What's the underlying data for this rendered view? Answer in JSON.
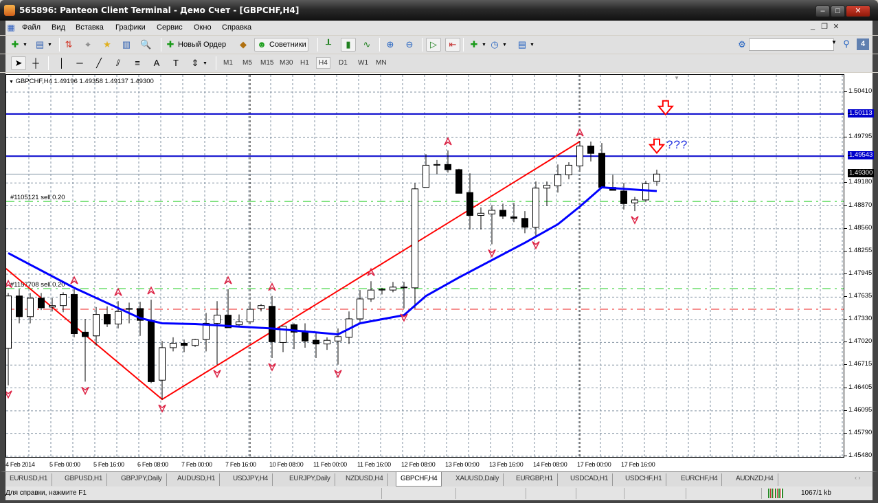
{
  "window": {
    "title": "565896: Panteon Client Terminal - Демо Счет - [GBPCHF,H4]"
  },
  "menu": [
    "Файл",
    "Вид",
    "Вставка",
    "Графики",
    "Сервис",
    "Окно",
    "Справка"
  ],
  "toolbar": {
    "new_order": "Новый Ордер",
    "experts": "Советники",
    "search_value": ""
  },
  "timeframes": [
    "M1",
    "M5",
    "M15",
    "M30",
    "H1",
    "H4",
    "D1",
    "W1",
    "MN"
  ],
  "active_timeframe": "H4",
  "chart": {
    "header": "GBPCHF,H4  1.49196 1.49358 1.49137 1.49300",
    "annotation": "???"
  },
  "chart_data": {
    "type": "candlestick",
    "symbol": "GBPCHF",
    "timeframe": "H4",
    "last_bar": {
      "open": 1.49196,
      "high": 1.49358,
      "low": 1.49137,
      "close": 1.493
    },
    "ylim": [
      1.4548,
      1.5041
    ],
    "candles": [
      [
        1.4694,
        1.4769,
        1.4644,
        1.4765
      ],
      [
        1.4765,
        1.4774,
        1.4728,
        1.4737
      ],
      [
        1.4737,
        1.4769,
        1.4728,
        1.4762
      ],
      [
        1.4762,
        1.4769,
        1.4746,
        1.4749
      ],
      [
        1.475,
        1.4762,
        1.4744,
        1.4752
      ],
      [
        1.4752,
        1.477,
        1.4743,
        1.4767
      ],
      [
        1.4767,
        1.4774,
        1.4709,
        1.4714
      ],
      [
        1.4716,
        1.4734,
        1.4649,
        1.471
      ],
      [
        1.4711,
        1.475,
        1.4698,
        1.474
      ],
      [
        1.474,
        1.4751,
        1.4723,
        1.4727
      ],
      [
        1.4727,
        1.4758,
        1.4721,
        1.4744
      ],
      [
        1.4747,
        1.4756,
        1.4728,
        1.4748
      ],
      [
        1.4748,
        1.4757,
        1.4711,
        1.4732
      ],
      [
        1.4732,
        1.476,
        1.4647,
        1.4649
      ],
      [
        1.4651,
        1.4704,
        1.4625,
        1.4695
      ],
      [
        1.4695,
        1.4709,
        1.469,
        1.4701
      ],
      [
        1.4701,
        1.4706,
        1.4689,
        1.4698
      ],
      [
        1.4698,
        1.4707,
        1.4696,
        1.4706
      ],
      [
        1.4706,
        1.4742,
        1.469,
        1.4728
      ],
      [
        1.4728,
        1.4758,
        1.4672,
        1.4739
      ],
      [
        1.4739,
        1.4774,
        1.4723,
        1.4722
      ],
      [
        1.4726,
        1.474,
        1.4723,
        1.473
      ],
      [
        1.473,
        1.4756,
        1.4728,
        1.4747
      ],
      [
        1.4748,
        1.4754,
        1.4744,
        1.4752
      ],
      [
        1.4751,
        1.4765,
        1.4681,
        1.4703
      ],
      [
        1.4702,
        1.4724,
        1.4689,
        1.4724
      ],
      [
        1.4726,
        1.4728,
        1.4693,
        1.4716
      ],
      [
        1.4716,
        1.4728,
        1.4695,
        1.4704
      ],
      [
        1.4705,
        1.4716,
        1.4681,
        1.47
      ],
      [
        1.47,
        1.4709,
        1.4692,
        1.4705
      ],
      [
        1.4704,
        1.4721,
        1.4672,
        1.471
      ],
      [
        1.4709,
        1.4744,
        1.47,
        1.4734
      ],
      [
        1.4734,
        1.4773,
        1.473,
        1.4761
      ],
      [
        1.4761,
        1.4785,
        1.4757,
        1.4773
      ],
      [
        1.4773,
        1.4776,
        1.4767,
        1.4774
      ],
      [
        1.4773,
        1.4784,
        1.477,
        1.4777
      ],
      [
        1.4777,
        1.4784,
        1.4748,
        1.4776
      ],
      [
        1.4776,
        1.4918,
        1.4748,
        1.491
      ],
      [
        1.4912,
        1.4957,
        1.4912,
        1.4942
      ],
      [
        1.4942,
        1.4949,
        1.493,
        1.4943
      ],
      [
        1.4943,
        1.4962,
        1.4932,
        1.4936
      ],
      [
        1.4936,
        1.4937,
        1.4904,
        1.4904
      ],
      [
        1.4905,
        1.4931,
        1.4855,
        1.4874
      ],
      [
        1.4874,
        1.4885,
        1.4855,
        1.4877
      ],
      [
        1.4876,
        1.4888,
        1.4835,
        1.4881
      ],
      [
        1.4881,
        1.489,
        1.4869,
        1.4873
      ],
      [
        1.4872,
        1.4891,
        1.4865,
        1.487
      ],
      [
        1.487,
        1.488,
        1.485,
        1.4858
      ],
      [
        1.4858,
        1.492,
        1.4846,
        1.4911
      ],
      [
        1.4911,
        1.492,
        1.4887,
        1.4915
      ],
      [
        1.4914,
        1.4943,
        1.4905,
        1.4929
      ],
      [
        1.4929,
        1.4946,
        1.4923,
        1.4942
      ],
      [
        1.4941,
        1.4974,
        1.4933,
        1.4968
      ],
      [
        1.4968,
        1.4974,
        1.4947,
        1.4958
      ],
      [
        1.4958,
        1.4972,
        1.4912,
        1.4912
      ],
      [
        1.4912,
        1.4929,
        1.4908,
        1.4908
      ],
      [
        1.4907,
        1.4918,
        1.4882,
        1.489
      ],
      [
        1.4891,
        1.4899,
        1.488,
        1.4895
      ],
      [
        1.4895,
        1.4921,
        1.4892,
        1.4917
      ],
      [
        1.492,
        1.4936,
        1.4914,
        1.493
      ]
    ],
    "moving_average": [
      [
        0,
        1.4823
      ],
      [
        6,
        1.4776
      ],
      [
        12,
        1.4735
      ],
      [
        14,
        1.4728
      ],
      [
        17,
        1.4727
      ],
      [
        24,
        1.4721
      ],
      [
        30,
        1.4713
      ],
      [
        32,
        1.4728
      ],
      [
        36,
        1.4739
      ],
      [
        38,
        1.4765
      ],
      [
        41,
        1.479
      ],
      [
        47,
        1.4837
      ],
      [
        50,
        1.4862
      ],
      [
        52,
        1.4886
      ],
      [
        54,
        1.4912
      ],
      [
        56,
        1.491
      ],
      [
        59,
        1.4907
      ]
    ],
    "zigzag": [
      [
        -0.2,
        1.4802
      ],
      [
        14,
        1.4625
      ],
      [
        52,
        1.4974
      ]
    ],
    "fractals_up": [
      [
        0,
        1.4769
      ],
      [
        6,
        1.4774
      ],
      [
        10,
        1.4758
      ],
      [
        13,
        1.476
      ],
      [
        20,
        1.4774
      ],
      [
        24,
        1.4765
      ],
      [
        33,
        1.4785
      ],
      [
        40,
        1.4962
      ],
      [
        52,
        1.4974
      ]
    ],
    "fractals_down": [
      [
        0,
        1.4644
      ],
      [
        7,
        1.4649
      ],
      [
        14,
        1.4625
      ],
      [
        19,
        1.4672
      ],
      [
        24,
        1.4681
      ],
      [
        30,
        1.4672
      ],
      [
        36,
        1.4748
      ],
      [
        44,
        1.4835
      ],
      [
        48,
        1.4846
      ],
      [
        57,
        1.488
      ]
    ],
    "hlines": [
      {
        "price": 1.50113,
        "color": "#0000cc",
        "style": "solid",
        "label": "1.50113"
      },
      {
        "price": 1.49543,
        "color": "#0000cc",
        "style": "solid",
        "label": "1.49543"
      },
      {
        "price": 1.493,
        "color": "#8899aa",
        "style": "thin",
        "label": "1.49300"
      },
      {
        "price": 1.4893,
        "color": "#22cc22",
        "style": "dashdot",
        "label": "#1105121 sell 0.20"
      },
      {
        "price": 1.4775,
        "color": "#22cc22",
        "style": "dashdot",
        "label": "#1157708 sell 0.20"
      },
      {
        "price": 1.4747,
        "color": "#ee2222",
        "style": "dashdot",
        "label": ""
      }
    ],
    "arrow_annotations": [
      [
        59.8,
        1.5018
      ],
      [
        59,
        1.4966
      ]
    ],
    "period_separators": [
      22,
      52
    ],
    "price_labels": [
      "1.50410",
      "1.49795",
      "1.49180",
      "1.48870",
      "1.48560",
      "1.48255",
      "1.47945",
      "1.47635",
      "1.47330",
      "1.47020",
      "1.46715",
      "1.46405",
      "1.46095",
      "1.45790",
      "1.45480"
    ],
    "time_labels": [
      [
        0,
        "4 Feb 2014"
      ],
      [
        4,
        "5 Feb 00:00"
      ],
      [
        8,
        "5 Feb 16:00"
      ],
      [
        12,
        "6 Feb 08:00"
      ],
      [
        16,
        "7 Feb 00:00"
      ],
      [
        20,
        "7 Feb 16:00"
      ],
      [
        24,
        "10 Feb 08:00"
      ],
      [
        28,
        "11 Feb 00:00"
      ],
      [
        32,
        "11 Feb 16:00"
      ],
      [
        36,
        "12 Feb 08:00"
      ],
      [
        40,
        "13 Feb 00:00"
      ],
      [
        44,
        "13 Feb 16:00"
      ],
      [
        48,
        "14 Feb 08:00"
      ],
      [
        52,
        "17 Feb 00:00"
      ],
      [
        56,
        "17 Feb 16:00"
      ]
    ],
    "colors": {
      "ma": "#0000ff",
      "zigzag": "#ff0000",
      "fractal": "#dd2244",
      "grid": "#8090a0"
    }
  },
  "tabs": [
    "EURUSD,H1",
    "GBPUSD,H1",
    "GBPJPY,Daily",
    "AUDUSD,H1",
    "USDJPY,H4",
    "EURJPY,Daily",
    "NZDUSD,H4",
    "GBPCHF,H4",
    "XAUUSD,Daily",
    "EURGBP,H1",
    "USDCAD,H1",
    "USDCHF,H1",
    "EURCHF,H4",
    "AUDNZD,H4"
  ],
  "active_tab": "GBPCHF,H4",
  "status": {
    "help": "Для справки, нажмите F1",
    "traffic": "1067/1 kb"
  }
}
